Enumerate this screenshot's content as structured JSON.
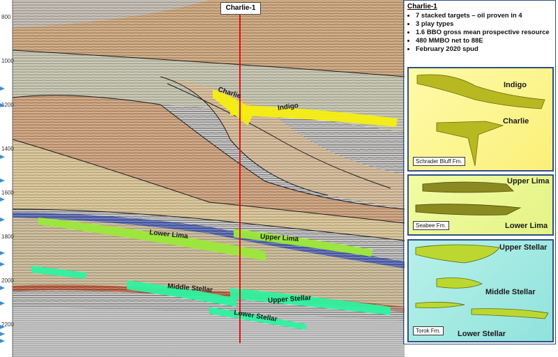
{
  "well": {
    "name": "Charlie-1"
  },
  "depth_axis": [
    "800",
    "1000",
    "1200",
    "1400",
    "1600",
    "1800",
    "2000",
    "2200"
  ],
  "targets": {
    "charlie": "Charlie",
    "indigo": "Indigo",
    "lower_lima": "Lower Lima",
    "upper_lima": "Upper  Lima",
    "middle_stellar": "Middle Stellar",
    "upper_stellar": "Upper Stellar",
    "lower_stellar": "Lower Stellar"
  },
  "info": {
    "title": "Charlie-1",
    "bullets": [
      "7 stacked targets – oil proven in 4",
      "3 play types",
      "1.6 BBO gross mean prospective resource",
      "480 MMBO net to 88E",
      "February 2020 spud"
    ]
  },
  "panels": [
    {
      "labels": [
        "Indigo",
        "Charlie"
      ],
      "formation": "Schrader Bluff Fm."
    },
    {
      "labels": [
        "Upper Lima",
        "Lower Lima"
      ],
      "formation": "Seabee Fm."
    },
    {
      "labels": [
        "Upper Stellar",
        "Middle Stellar",
        "Lower Stellar"
      ],
      "formation": "Torok Fm."
    }
  ],
  "colors": {
    "schrader_targets": "#f6ee12",
    "lima_targets": "#9be83a",
    "stellar_targets": "#2ff2a0",
    "well_track": "#e01010",
    "panel_border": "#2d4f86"
  }
}
